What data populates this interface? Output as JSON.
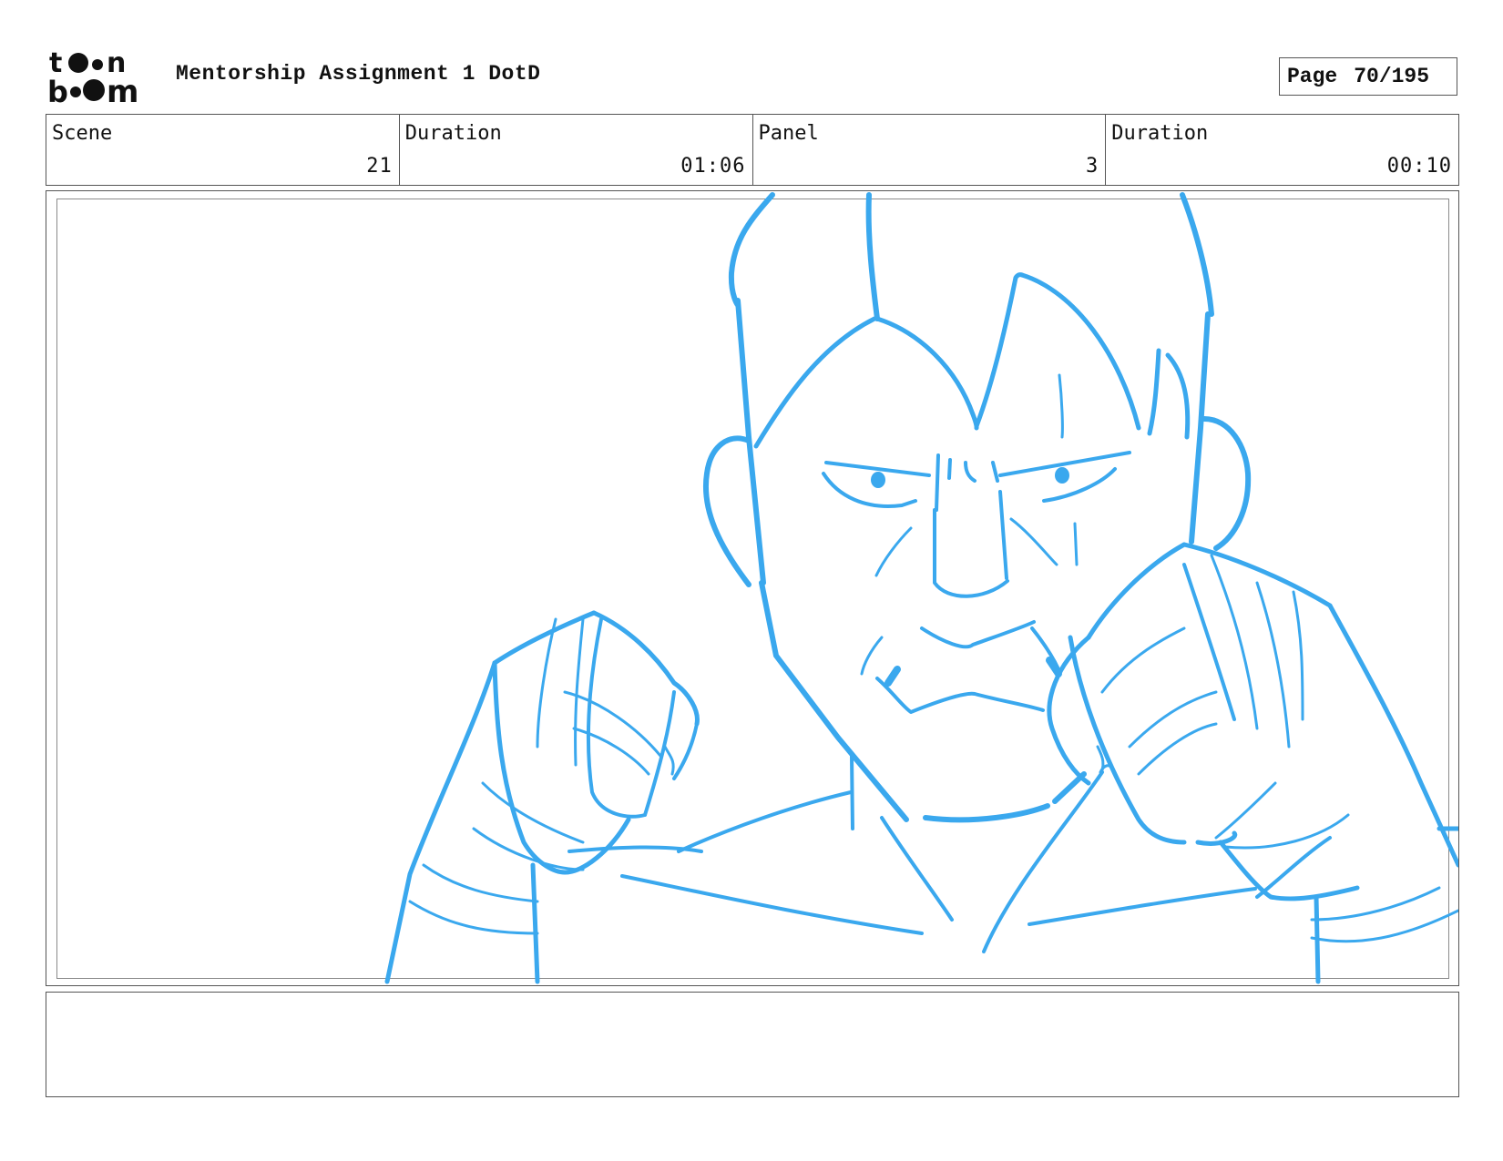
{
  "header": {
    "logo_text": "toon boom",
    "title": "Mentorship Assignment 1 DotD",
    "page_label": "Page",
    "page_value": "70/195"
  },
  "info": {
    "scene_label": "Scene",
    "scene_value": "21",
    "scene_duration_label": "Duration",
    "scene_duration_value": "01:06",
    "panel_label": "Panel",
    "panel_value": "3",
    "panel_duration_label": "Duration",
    "panel_duration_value": "00:10"
  },
  "sketch": {
    "stroke_color": "#3aa8ee",
    "subject": "rough storyboard sketch: character with raised clenched fists, angry expression"
  },
  "notes": {
    "text": ""
  }
}
